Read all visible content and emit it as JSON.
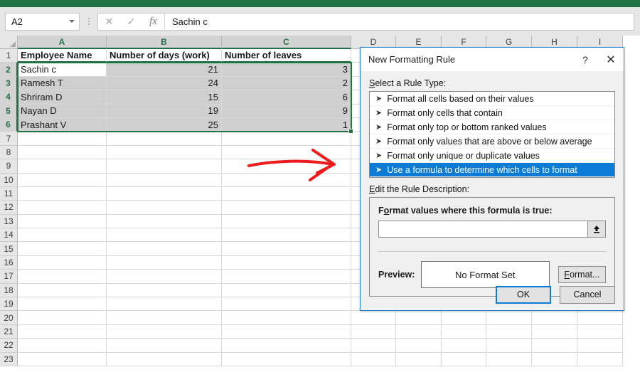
{
  "app": {
    "accent_green": "#217346",
    "selection_blue": "#0b7bd5"
  },
  "formula_bar": {
    "name_box_value": "A2",
    "cancel_icon": "close-icon",
    "confirm_icon": "check-icon",
    "function_icon": "fx-icon",
    "formula_value": "Sachin c"
  },
  "sheet": {
    "column_headers": [
      "A",
      "B",
      "C",
      "D",
      "E",
      "F",
      "G",
      "H",
      "I"
    ],
    "selected_columns": [
      "A",
      "B",
      "C"
    ],
    "row_headers": [
      "1",
      "2",
      "3",
      "4",
      "5",
      "6",
      "7",
      "8",
      "9",
      "10",
      "11",
      "12",
      "13",
      "14",
      "15",
      "16",
      "17",
      "18",
      "19",
      "20",
      "21",
      "22",
      "23"
    ],
    "selected_rows": [
      "2",
      "3",
      "4",
      "5",
      "6"
    ],
    "table_headers": [
      "Employee Name",
      "Number of days (work)",
      "Number of leaves"
    ],
    "rows": [
      {
        "name": "Sachin c",
        "days": "21",
        "leaves": "3"
      },
      {
        "name": "Ramesh T",
        "days": "24",
        "leaves": "2"
      },
      {
        "name": "Shriram D",
        "days": "15",
        "leaves": "6"
      },
      {
        "name": "Nayan D",
        "days": "19",
        "leaves": "9"
      },
      {
        "name": "Prashant V",
        "days": "25",
        "leaves": "1"
      }
    ],
    "active_cell": "A2",
    "selected_range": "A2:C6"
  },
  "annotation": {
    "arrow_color": "#ee1b1b",
    "arrow_name": "red-arrow-pointing-to-selected-rule"
  },
  "dialog": {
    "title": "New Formatting Rule",
    "help_label": "?",
    "close_label": "✕",
    "rule_type_label": "Select a Rule Type:",
    "rule_type_label_accel": "S",
    "rule_types": [
      {
        "label": "Format all cells based on their values",
        "selected": false
      },
      {
        "label": "Format only cells that contain",
        "selected": false
      },
      {
        "label": "Format only top or bottom ranked values",
        "selected": false
      },
      {
        "label": "Format only values that are above or below average",
        "selected": false
      },
      {
        "label": "Format only unique or duplicate values",
        "selected": false
      },
      {
        "label": "Use a formula to determine which cells to format",
        "selected": true
      }
    ],
    "description_label": "Edit the Rule Description:",
    "description_label_accel": "E",
    "formula_prompt": "Format values where this formula is true:",
    "formula_prompt_accel": "o",
    "formula_value": "",
    "range_select_icon": "collapse-dialog-icon",
    "preview_label": "Preview:",
    "preview_text": "No Format Set",
    "format_button": "Format...",
    "format_button_accel": "F",
    "ok_button": "OK",
    "cancel_button": "Cancel"
  }
}
